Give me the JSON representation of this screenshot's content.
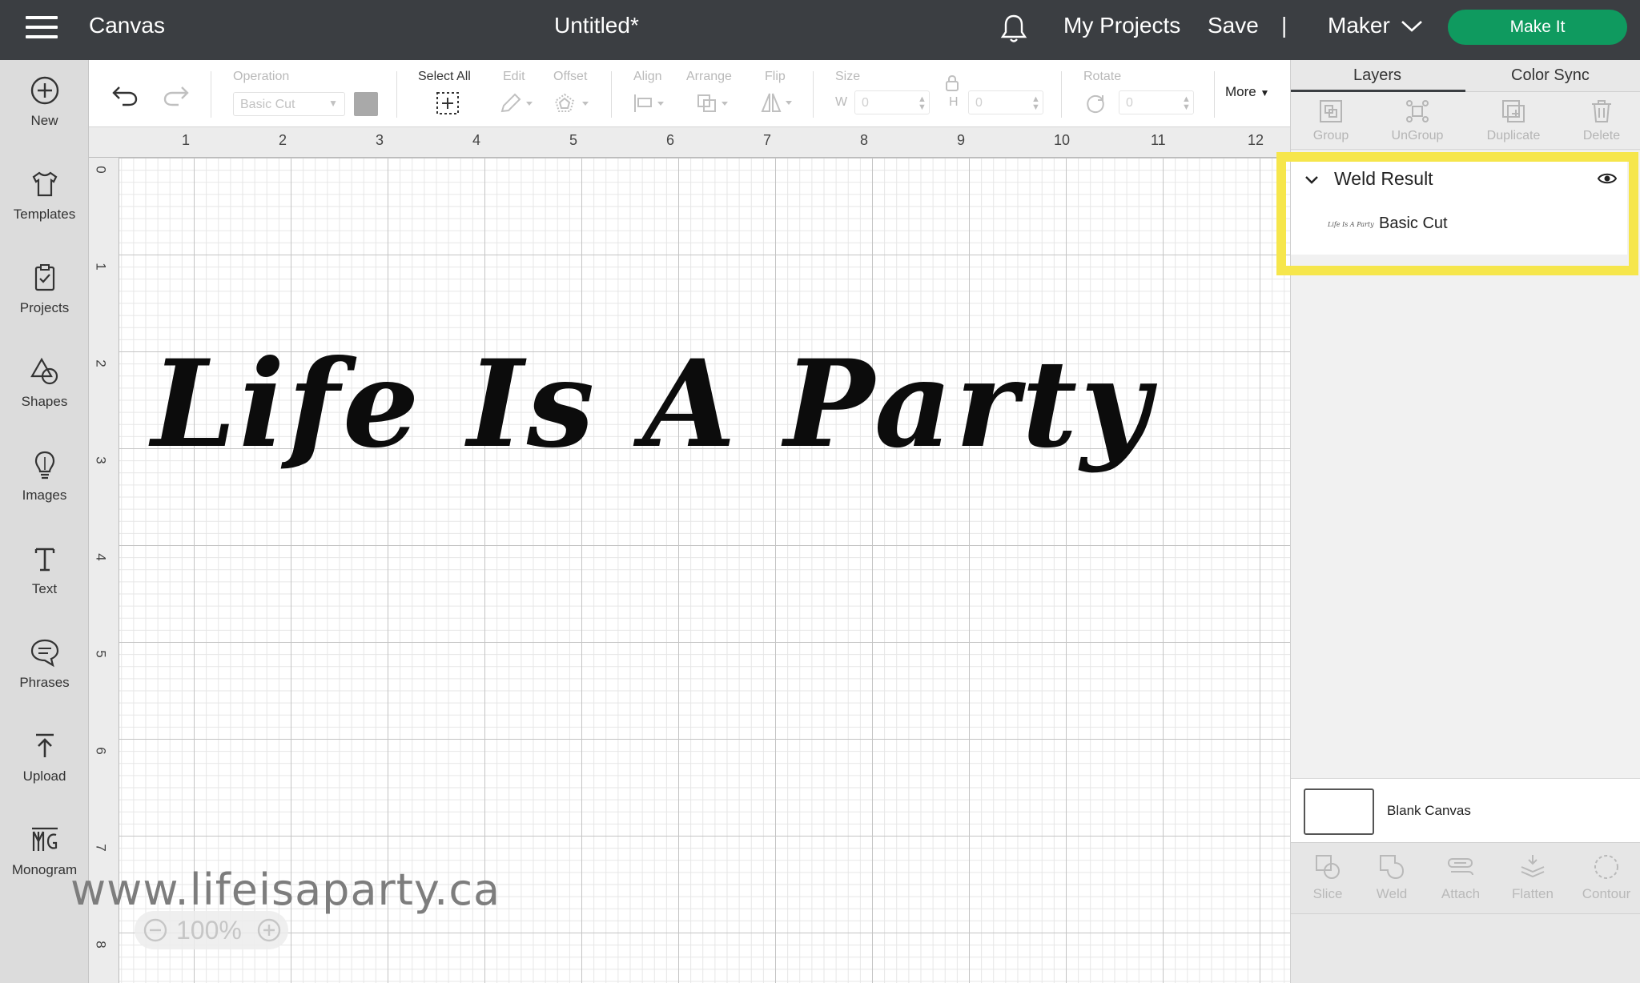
{
  "header": {
    "menu_icon": "hamburger-icon",
    "app_title": "Canvas",
    "document_title": "Untitled*",
    "notification_icon": "bell-icon",
    "my_projects_label": "My Projects",
    "save_label": "Save",
    "separator": "|",
    "machine_label": "Maker",
    "make_it_label": "Make It",
    "make_it_color": "#0f9a5f",
    "bar_color": "#3b3e42"
  },
  "sidebar": {
    "items": [
      {
        "label": "New",
        "icon": "plus-circle-icon"
      },
      {
        "label": "Templates",
        "icon": "shirt-icon"
      },
      {
        "label": "Projects",
        "icon": "clipboard-icon"
      },
      {
        "label": "Shapes",
        "icon": "shapes-icon"
      },
      {
        "label": "Images",
        "icon": "lightbulb-icon"
      },
      {
        "label": "Text",
        "icon": "text-icon"
      },
      {
        "label": "Phrases",
        "icon": "speech-bubble-icon"
      },
      {
        "label": "Upload",
        "icon": "upload-icon"
      },
      {
        "label": "Monogram",
        "icon": "monogram-icon"
      }
    ]
  },
  "toolbar": {
    "undo_icon": "undo-icon",
    "redo_icon": "redo-icon",
    "operation_label": "Operation",
    "operation_value": "Basic Cut",
    "select_all_label": "Select All",
    "edit_label": "Edit",
    "offset_label": "Offset",
    "align_label": "Align",
    "arrange_label": "Arrange",
    "flip_label": "Flip",
    "size_label": "Size",
    "width_label": "W",
    "width_value": "0",
    "height_label": "H",
    "height_value": "0",
    "rotate_label": "Rotate",
    "rotate_value": "0",
    "more_label": "More"
  },
  "rulers": {
    "horizontal": [
      "1",
      "2",
      "3",
      "4",
      "5",
      "6",
      "7",
      "8",
      "9",
      "10",
      "11",
      "12"
    ],
    "vertical": [
      "0",
      "1",
      "2",
      "3",
      "4",
      "5",
      "6",
      "7",
      "8"
    ]
  },
  "canvas": {
    "design_text": "Life Is A Party",
    "watermark": "www.lifeisaparty.ca",
    "zoom_level": "100%"
  },
  "right_panel": {
    "tabs": [
      "Layers",
      "Color Sync"
    ],
    "active_tab": "Layers",
    "layer_tools": [
      "Group",
      "UnGroup",
      "Duplicate",
      "Delete"
    ],
    "group_name": "Weld Result",
    "child_layer": "Basic Cut",
    "child_thumbnail_text": "Life Is A Party",
    "highlight_color": "#f6e64b",
    "blank_canvas_label": "Blank Canvas",
    "bottom_tools": [
      "Slice",
      "Weld",
      "Attach",
      "Flatten",
      "Contour"
    ]
  }
}
